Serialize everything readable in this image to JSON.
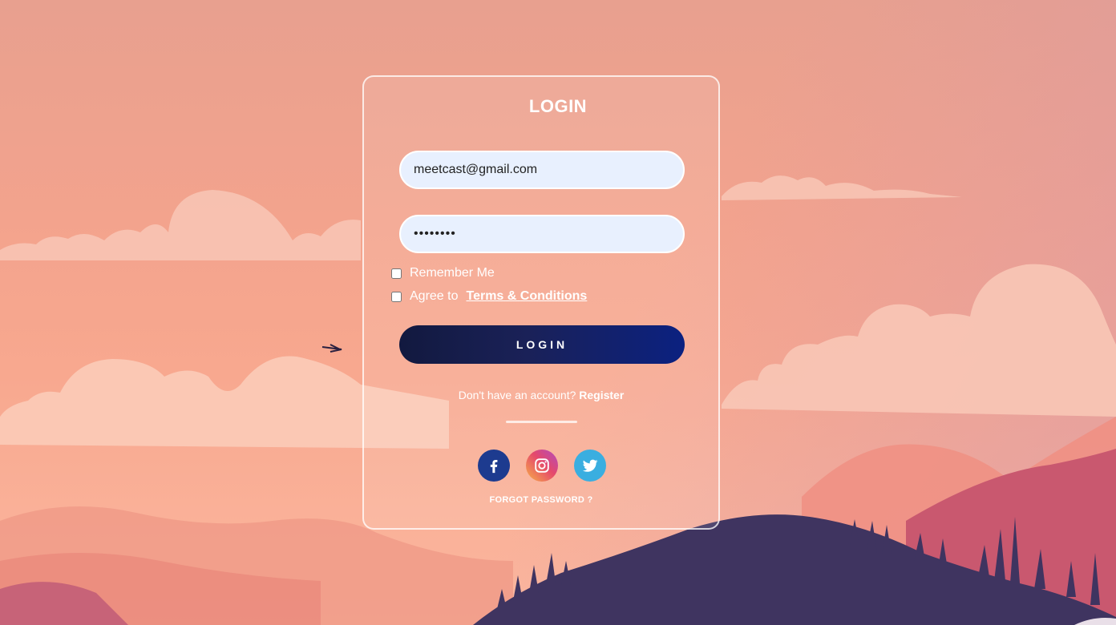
{
  "login": {
    "title": "LOGIN",
    "email_value": "meetcast@gmail.com",
    "password_value": "••••••••",
    "remember_label": "Remember Me",
    "agree_label": "Agree to",
    "terms_label": "Terms & Conditions",
    "button_label": "LOGIN",
    "no_account_text": "Don't have an account?",
    "register_label": "Register",
    "forgot_label": "FORGOT PASSWORD ?"
  },
  "social": {
    "icons": [
      "facebook-icon",
      "instagram-icon",
      "twitter-icon"
    ]
  },
  "colors": {
    "button_start": "#12193f",
    "button_end": "#0b2180",
    "input_bg": "#e8f0fe",
    "facebook": "#1d3b8f",
    "twitter": "#3aaee0"
  }
}
